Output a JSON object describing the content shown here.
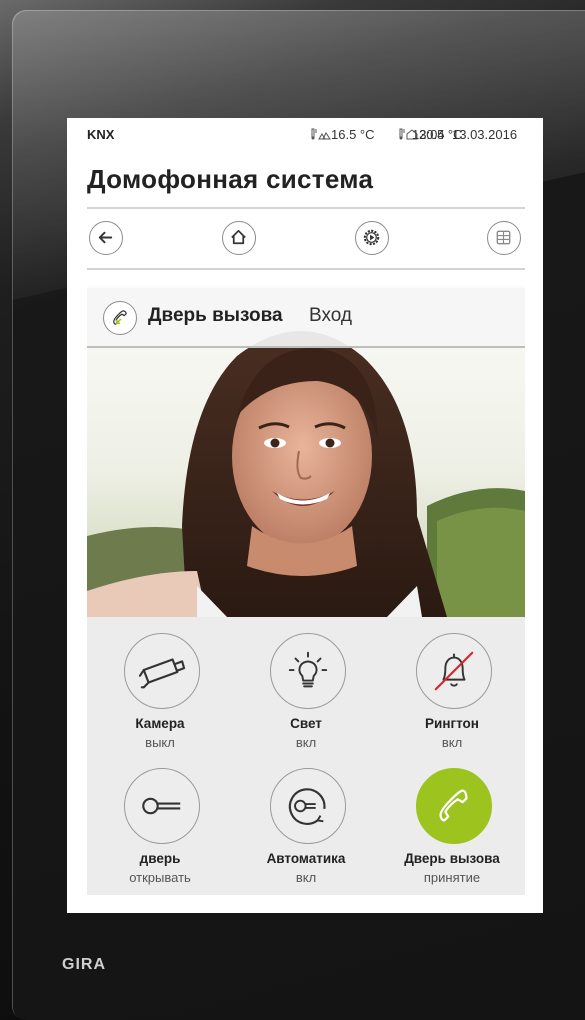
{
  "status": {
    "knx": "KNX",
    "outdoor_temp": "16.5 °C",
    "indoor_temp": "20.5 °C",
    "time": "13:04",
    "date": "13.03.2016"
  },
  "page_title": "Домофонная система",
  "nav": {
    "back_icon": "arrow-left-icon",
    "home_icon": "home-icon",
    "settings_icon": "play-gear-icon",
    "grid_icon": "grid-icon"
  },
  "call_banner": {
    "icon": "incoming-call-icon",
    "name": "Дверь вызова",
    "location": "Вход"
  },
  "controls": [
    {
      "label": "Камера",
      "state": "выкл",
      "icon": "camera-icon"
    },
    {
      "label": "Свет",
      "state": "вкл",
      "icon": "light-bulb-icon"
    },
    {
      "label": "Рингтон",
      "state": "вкл",
      "icon": "bell-muted-icon"
    },
    {
      "label": "дверь",
      "state": "открывать",
      "icon": "key-icon"
    },
    {
      "label": "Автоматика",
      "state": "вкл",
      "icon": "auto-key-icon"
    },
    {
      "label": "Дверь вызова",
      "state": "принятие",
      "icon": "phone-icon"
    }
  ],
  "colors": {
    "accent": "#9dc31f",
    "screen_bg": "#ffffff",
    "control_bg": "#ececec",
    "frame": "#141414"
  },
  "brand": "GIRA"
}
